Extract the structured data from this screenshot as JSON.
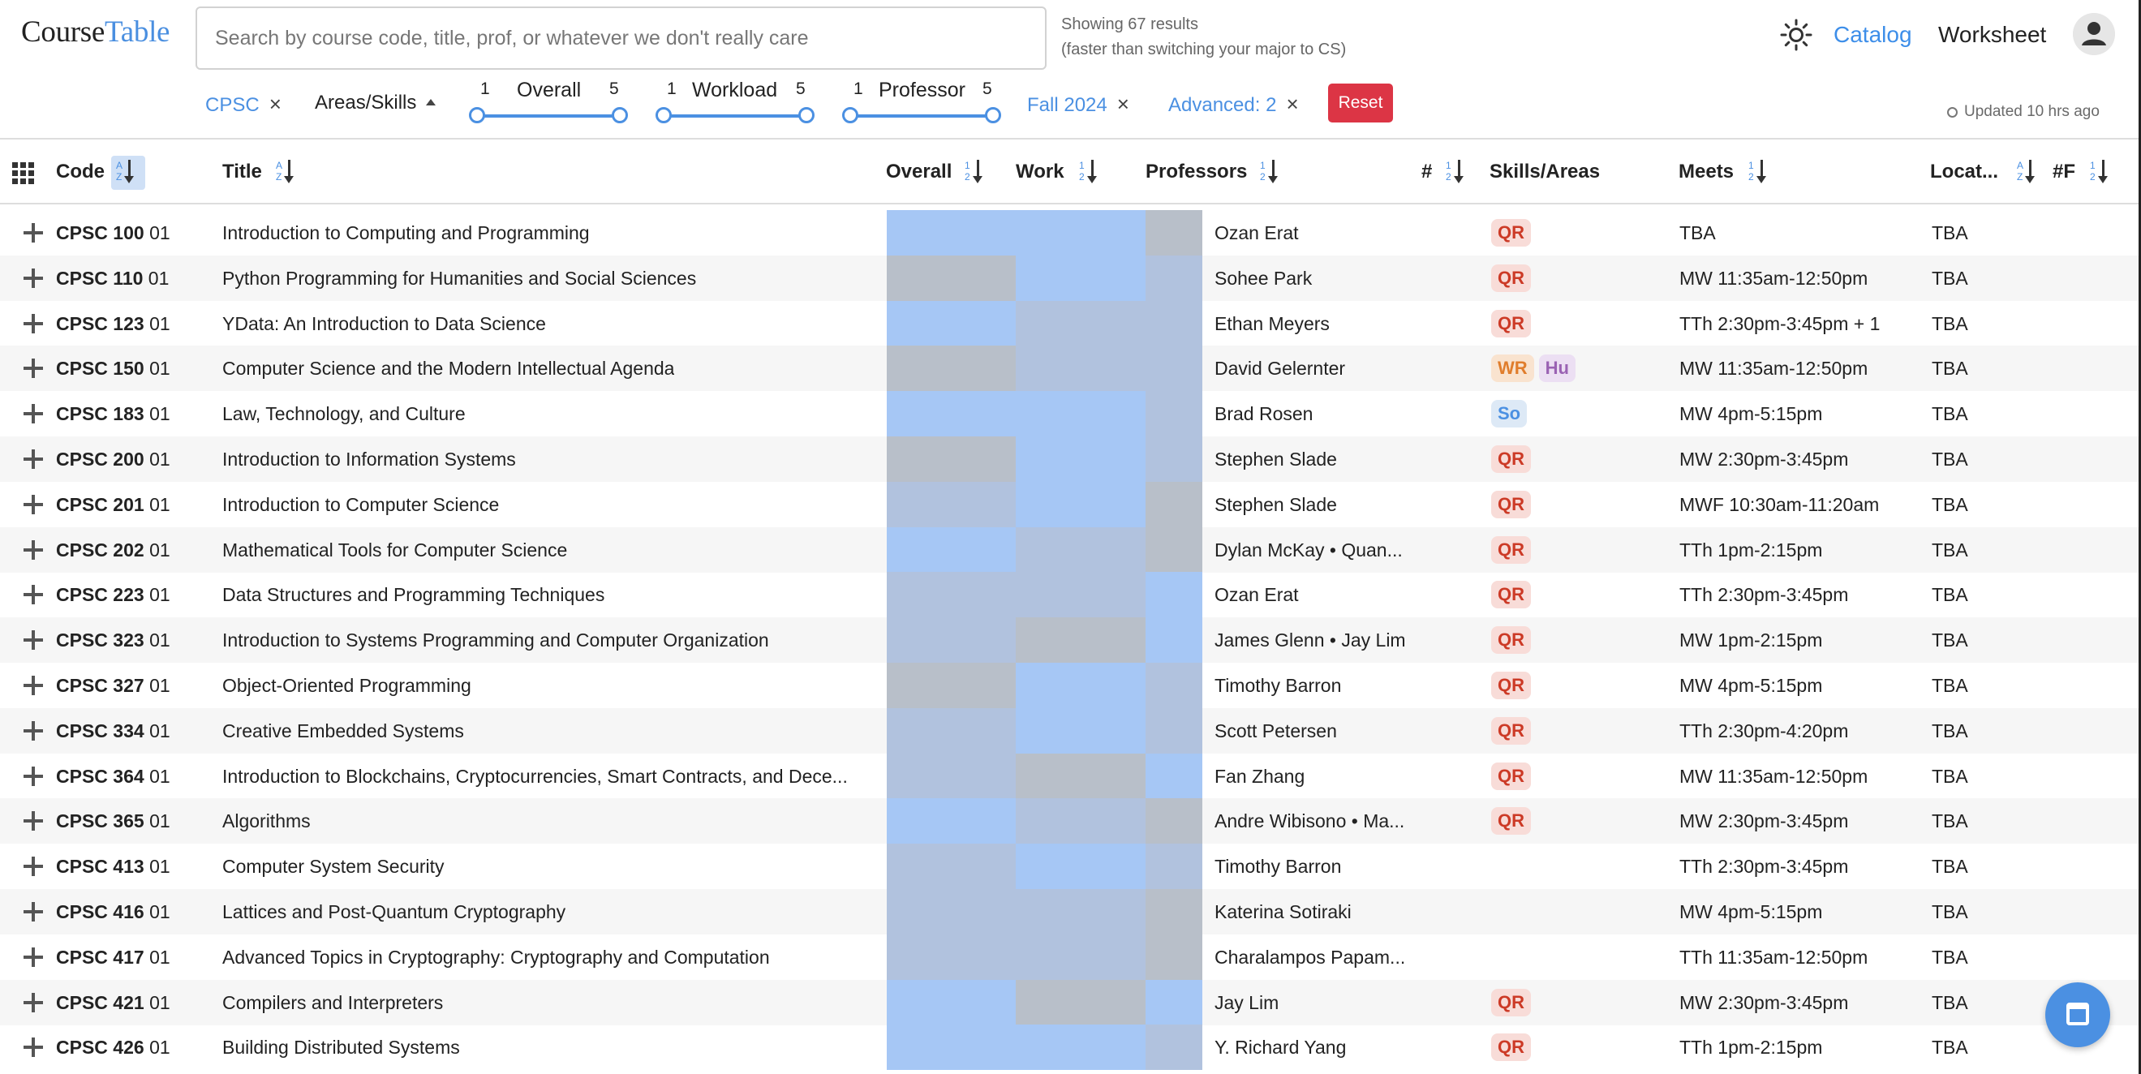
{
  "app": {
    "logo_part1": "Course",
    "logo_part2": "Table",
    "brand_color": "#4b90e2"
  },
  "search": {
    "placeholder": "Search by course code, title, prof, or whatever we don't really care",
    "value": ""
  },
  "results": {
    "line1": "Showing 67 results",
    "line2": "(faster than switching your major to CS)"
  },
  "nav": {
    "theme_icon": "sun-icon",
    "catalog": "Catalog",
    "worksheet": "Worksheet",
    "profile_icon": "user-icon"
  },
  "filters": {
    "subject": "CPSC",
    "areas_skills": "Areas/Skills",
    "overall": {
      "label": "Overall",
      "min": "1",
      "max": "5"
    },
    "workload": {
      "label": "Workload",
      "min": "1",
      "max": "5"
    },
    "professor": {
      "label": "Professor",
      "min": "1",
      "max": "5"
    },
    "season": "Fall 2024",
    "advanced": "Advanced: 2",
    "reset": "Reset",
    "updated": "Updated 10 hrs ago",
    "remove_glyph": "×"
  },
  "columns": {
    "code": "Code",
    "title": "Title",
    "overall": "Overall",
    "work": "Work",
    "professors": "Professors",
    "num": "#",
    "skills_areas": "Skills/Areas",
    "meets": "Meets",
    "location": "Locat...",
    "num_f": "#F",
    "sort_alpha": [
      "A",
      "Z"
    ],
    "sort_num": [
      "1",
      "2"
    ]
  },
  "rating_colors": {
    "blue": "#a6c7f5",
    "blue_gray": "#b1c2de",
    "gray": "#b8bfc9"
  },
  "courses": [
    {
      "subject": "CPSC 100",
      "section": "01",
      "title": "Introduction to Computing and Programming",
      "overall": "blue",
      "work": "blue",
      "prof_rating": "gray",
      "professors": "Ozan Erat",
      "skills": [
        "QR"
      ],
      "meets": "TBA",
      "location": "TBA"
    },
    {
      "subject": "CPSC 110",
      "section": "01",
      "title": "Python Programming for Humanities and Social Sciences",
      "overall": "gray",
      "work": "blue",
      "prof_rating": "blue_gray",
      "professors": "Sohee Park",
      "skills": [
        "QR"
      ],
      "meets": "MW 11:35am-12:50pm",
      "location": "TBA"
    },
    {
      "subject": "CPSC 123",
      "section": "01",
      "title": "YData: An Introduction to Data Science",
      "overall": "blue",
      "work": "blue_gray",
      "prof_rating": "blue_gray",
      "professors": "Ethan Meyers",
      "skills": [
        "QR"
      ],
      "meets": "TTh 2:30pm-3:45pm + 1",
      "location": "TBA"
    },
    {
      "subject": "CPSC 150",
      "section": "01",
      "title": "Computer Science and the Modern Intellectual Agenda",
      "overall": "gray",
      "work": "blue_gray",
      "prof_rating": "blue_gray",
      "professors": "David Gelernter",
      "skills": [
        "WR",
        "Hu"
      ],
      "meets": "MW 11:35am-12:50pm",
      "location": "TBA"
    },
    {
      "subject": "CPSC 183",
      "section": "01",
      "title": "Law, Technology, and Culture",
      "overall": "blue",
      "work": "blue",
      "prof_rating": "blue_gray",
      "professors": "Brad Rosen",
      "skills": [
        "So"
      ],
      "meets": "MW 4pm-5:15pm",
      "location": "TBA"
    },
    {
      "subject": "CPSC 200",
      "section": "01",
      "title": "Introduction to Information Systems",
      "overall": "gray",
      "work": "blue",
      "prof_rating": "blue_gray",
      "professors": "Stephen Slade",
      "skills": [
        "QR"
      ],
      "meets": "MW 2:30pm-3:45pm",
      "location": "TBA"
    },
    {
      "subject": "CPSC 201",
      "section": "01",
      "title": "Introduction to Computer Science",
      "overall": "blue_gray",
      "work": "blue",
      "prof_rating": "gray",
      "professors": "Stephen Slade",
      "skills": [
        "QR"
      ],
      "meets": "MWF 10:30am-11:20am",
      "location": "TBA"
    },
    {
      "subject": "CPSC 202",
      "section": "01",
      "title": "Mathematical Tools for Computer Science",
      "overall": "blue",
      "work": "blue_gray",
      "prof_rating": "gray",
      "professors": "Dylan McKay • Quan...",
      "skills": [
        "QR"
      ],
      "meets": "TTh 1pm-2:15pm",
      "location": "TBA"
    },
    {
      "subject": "CPSC 223",
      "section": "01",
      "title": "Data Structures and Programming Techniques",
      "overall": "blue_gray",
      "work": "blue_gray",
      "prof_rating": "blue",
      "professors": "Ozan Erat",
      "skills": [
        "QR"
      ],
      "meets": "TTh 2:30pm-3:45pm",
      "location": "TBA"
    },
    {
      "subject": "CPSC 323",
      "section": "01",
      "title": "Introduction to Systems Programming and Computer Organization",
      "overall": "blue_gray",
      "work": "gray",
      "prof_rating": "blue",
      "professors": "James Glenn • Jay Lim",
      "skills": [
        "QR"
      ],
      "meets": "MW 1pm-2:15pm",
      "location": "TBA"
    },
    {
      "subject": "CPSC 327",
      "section": "01",
      "title": "Object-Oriented Programming",
      "overall": "gray",
      "work": "blue",
      "prof_rating": "blue_gray",
      "professors": "Timothy Barron",
      "skills": [
        "QR"
      ],
      "meets": "MW 4pm-5:15pm",
      "location": "TBA"
    },
    {
      "subject": "CPSC 334",
      "section": "01",
      "title": "Creative Embedded Systems",
      "overall": "blue_gray",
      "work": "blue",
      "prof_rating": "blue_gray",
      "professors": "Scott Petersen",
      "skills": [
        "QR"
      ],
      "meets": "TTh 2:30pm-4:20pm",
      "location": "TBA"
    },
    {
      "subject": "CPSC 364",
      "section": "01",
      "title": "Introduction to Blockchains, Cryptocurrencies, Smart Contracts, and Dece...",
      "overall": "blue_gray",
      "work": "gray",
      "prof_rating": "blue",
      "professors": "Fan Zhang",
      "skills": [
        "QR"
      ],
      "meets": "MW 11:35am-12:50pm",
      "location": "TBA"
    },
    {
      "subject": "CPSC 365",
      "section": "01",
      "title": "Algorithms",
      "overall": "blue",
      "work": "blue_gray",
      "prof_rating": "gray",
      "professors": "Andre Wibisono • Ma...",
      "skills": [
        "QR"
      ],
      "meets": "MW 2:30pm-3:45pm",
      "location": "TBA"
    },
    {
      "subject": "CPSC 413",
      "section": "01",
      "title": "Computer System Security",
      "overall": "blue_gray",
      "work": "blue",
      "prof_rating": "blue_gray",
      "professors": "Timothy Barron",
      "skills": [],
      "meets": "TTh 2:30pm-3:45pm",
      "location": "TBA"
    },
    {
      "subject": "CPSC 416",
      "section": "01",
      "title": "Lattices and Post-Quantum Cryptography",
      "overall": "blue_gray",
      "work": "blue_gray",
      "prof_rating": "gray",
      "professors": "Katerina Sotiraki",
      "skills": [],
      "meets": "MW 4pm-5:15pm",
      "location": "TBA"
    },
    {
      "subject": "CPSC 417",
      "section": "01",
      "title": "Advanced Topics in Cryptography: Cryptography and Computation",
      "overall": "blue_gray",
      "work": "blue_gray",
      "prof_rating": "gray",
      "professors": "Charalampos Papam...",
      "skills": [],
      "meets": "TTh 11:35am-12:50pm",
      "location": "TBA"
    },
    {
      "subject": "CPSC 421",
      "section": "01",
      "title": "Compilers and Interpreters",
      "overall": "blue",
      "work": "gray",
      "prof_rating": "blue",
      "professors": "Jay Lim",
      "skills": [
        "QR"
      ],
      "meets": "MW 2:30pm-3:45pm",
      "location": "TBA"
    },
    {
      "subject": "CPSC 426",
      "section": "01",
      "title": "Building Distributed Systems",
      "overall": "blue",
      "work": "blue",
      "prof_rating": "blue_gray",
      "professors": "Y. Richard Yang",
      "skills": [
        "QR"
      ],
      "meets": "TTh 1pm-2:15pm",
      "location": "TBA"
    }
  ],
  "calendar_button_icon": "calendar-icon"
}
